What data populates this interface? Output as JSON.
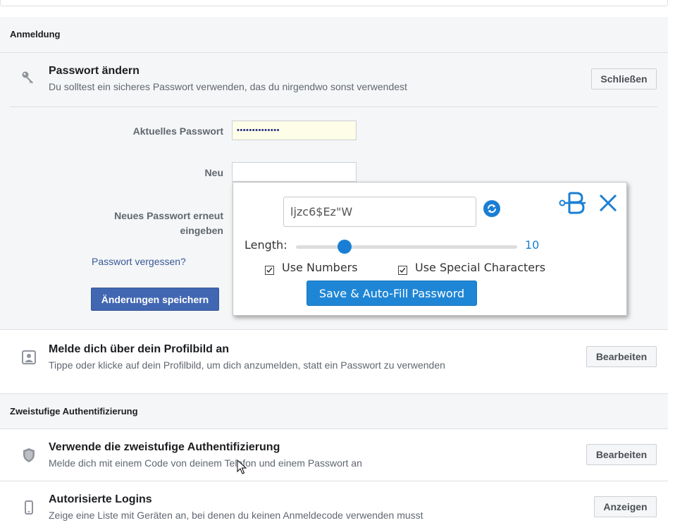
{
  "sections": {
    "login": "Anmeldung",
    "two_factor": "Zweistufige Authentifizierung"
  },
  "password_change": {
    "icon": "key-icon",
    "title": "Passwort ändern",
    "description": "Du solltest ein sicheres Passwort verwenden, das du nirgendwo sonst verwendest",
    "close_label": "Schließen",
    "current_label": "Aktuelles Passwort",
    "current_value": "••••••••••••••",
    "new_label": "Neu",
    "new_value": "",
    "repeat_label_line1": "Neues Passwort erneut",
    "repeat_label_line2": "eingeben",
    "forgot_link": "Passwort vergessen?",
    "save_label": "Änderungen speichern"
  },
  "generator": {
    "password": "ljzc6$Ez\"W",
    "refresh_icon": "refresh-icon",
    "logo_icon": "bitwarden-logo-icon",
    "close_icon": "close-icon",
    "length_label": "Length:",
    "length_value": "10",
    "length_fraction": 0.22,
    "use_numbers_label": "Use Numbers",
    "use_numbers": true,
    "use_special_label": "Use Special Characters",
    "use_special": true,
    "save_label": "Save & Auto-Fill Password",
    "accent_color": "#1a7fd4"
  },
  "rows": [
    {
      "icon": "profile-picture-icon",
      "title": "Melde dich über dein Profilbild an",
      "description": "Tippe oder klicke auf dein Profilbild, um dich anzumelden, statt ein Passwort zu verwenden",
      "button": "Bearbeiten"
    },
    {
      "icon": "shield-icon",
      "title": "Verwende die zweistufige Authentifizierung",
      "description": "Melde dich mit einem Code von deinem Telefon und einem Passwort an",
      "button": "Bearbeiten"
    },
    {
      "icon": "mobile-phone-icon",
      "title": "Autorisierte Logins",
      "description": "Zeige eine Liste mit Geräten an, bei denen du keinen Anmeldecode verwenden musst",
      "button": "Anzeigen"
    }
  ]
}
